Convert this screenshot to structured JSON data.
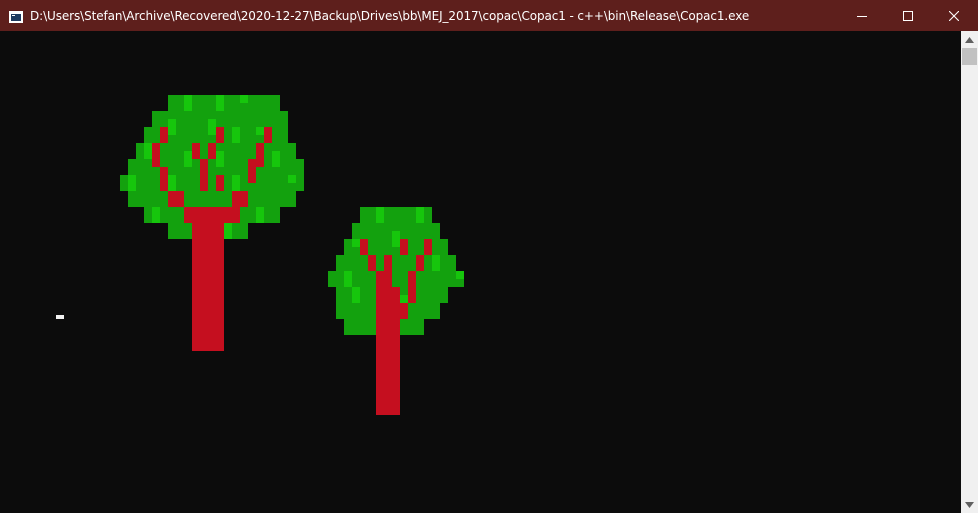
{
  "window": {
    "title": "D:\\Users\\Stefan\\Archive\\Recovered\\2020-12-27\\Backup\\Drives\\bb\\MEJ_2017\\copac\\Copac1 - c++\\bin\\Release\\Copac1.exe",
    "titlebar_color": "#5e1f1c",
    "console_background": "#0c0c0c",
    "icons": {
      "app": "console-app-icon",
      "minimize": "minimize-icon",
      "maximize": "maximize-icon",
      "close": "close-icon"
    }
  },
  "console": {
    "colors": {
      "leaf_dark": "#13a10e",
      "leaf_light": "#16c60c",
      "trunk": "#c50f1f",
      "cursor": "#f2f2f2"
    }
  },
  "scrollbar": {
    "icons": {
      "up": "scroll-up-arrow-icon",
      "down": "scroll-down-arrow-icon"
    }
  }
}
